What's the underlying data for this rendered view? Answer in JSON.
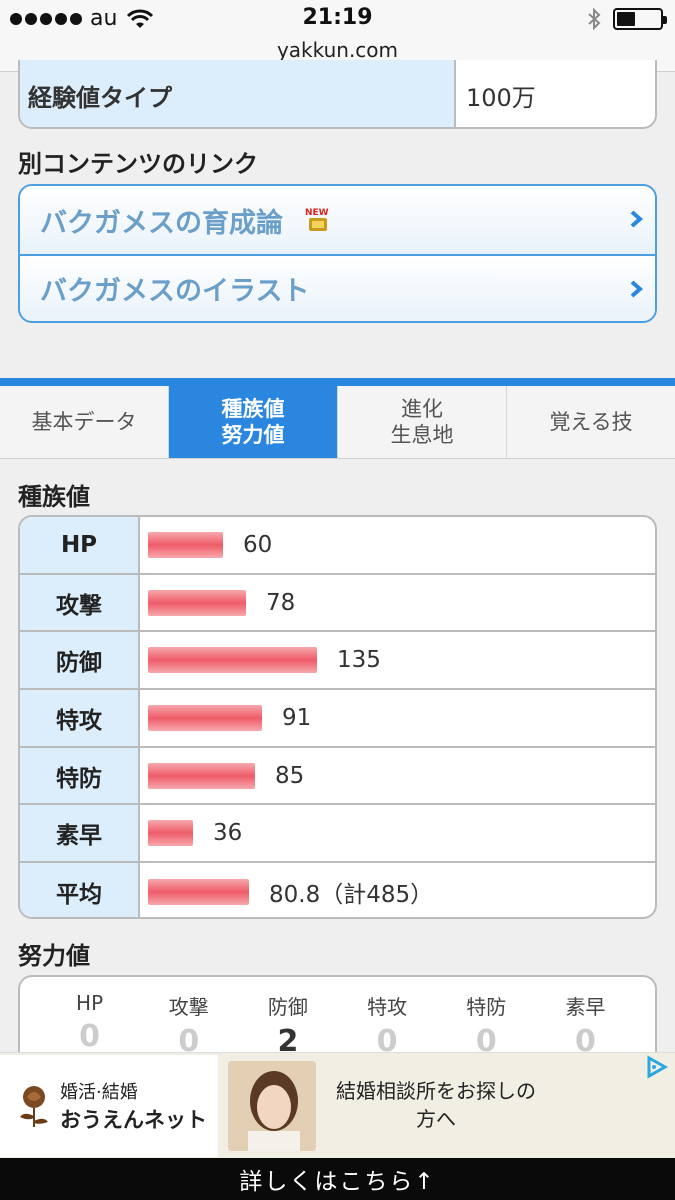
{
  "status_bar": {
    "carrier": "au",
    "time": "21:19",
    "url": "yakkun.com"
  },
  "top_table": {
    "label": "経験値タイプ",
    "value": "100万"
  },
  "other_links": {
    "title": "別コンテンツのリンク",
    "items": [
      {
        "label": "バクガメスの育成論",
        "badge": "NEW"
      },
      {
        "label": "バクガメスのイラスト"
      }
    ]
  },
  "tabs": [
    {
      "label": "基本データ",
      "active": false
    },
    {
      "label": "種族値\n努力値",
      "active": true
    },
    {
      "label": "進化\n生息地",
      "active": false
    },
    {
      "label": "覚える技",
      "active": false
    }
  ],
  "base_stats": {
    "title": "種族値",
    "max_value": 255,
    "rows": [
      {
        "label": "HP",
        "value": 60,
        "display": "60"
      },
      {
        "label": "攻撃",
        "value": 78,
        "display": "78"
      },
      {
        "label": "防御",
        "value": 135,
        "display": "135"
      },
      {
        "label": "特攻",
        "value": 91,
        "display": "91"
      },
      {
        "label": "特防",
        "value": 85,
        "display": "85"
      },
      {
        "label": "素早",
        "value": 36,
        "display": "36"
      },
      {
        "label": "平均",
        "value": 80.8,
        "display": "80.8（計485）"
      }
    ]
  },
  "effort_values": {
    "title": "努力値",
    "items": [
      {
        "label": "HP",
        "value": "0"
      },
      {
        "label": "攻撃",
        "value": "0"
      },
      {
        "label": "防御",
        "value": "2"
      },
      {
        "label": "特攻",
        "value": "0"
      },
      {
        "label": "特防",
        "value": "0"
      },
      {
        "label": "素早",
        "value": "0"
      }
    ]
  },
  "ad": {
    "logo_small": "婚活·結婚",
    "logo_big": "おうえんネット",
    "text": "結婚相談所をお探しの方へ"
  },
  "cta": "詳しくはこちら↑",
  "colors": {
    "accent": "#2b86e0",
    "bar": "#ee5c68",
    "label_bg": "#dceefb"
  }
}
